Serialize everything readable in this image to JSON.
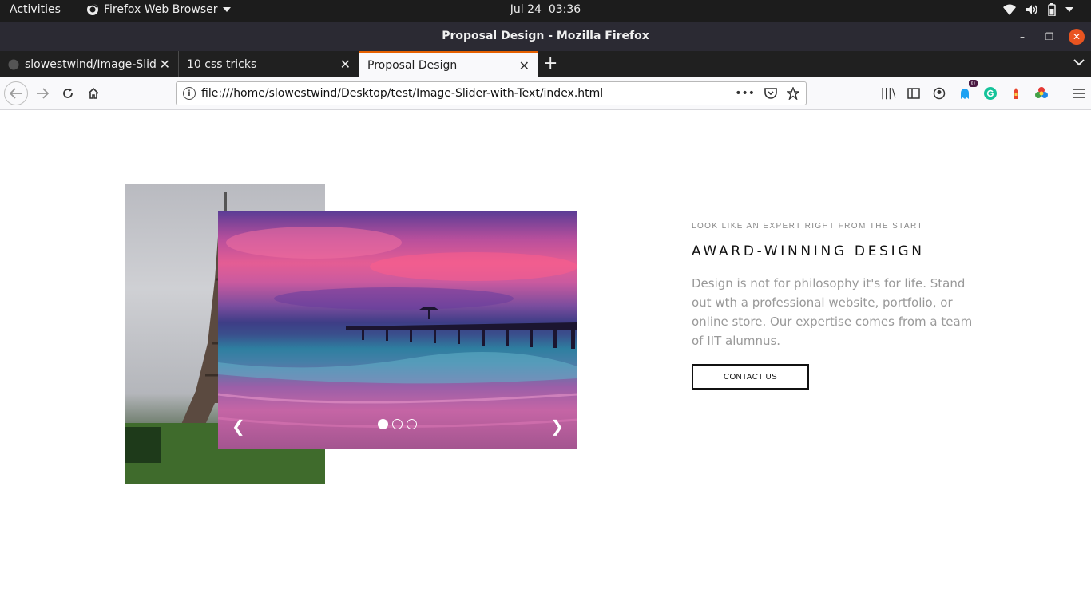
{
  "system_bar": {
    "activities": "Activities",
    "app_name": "Firefox Web Browser",
    "date": "Jul 24",
    "time": "03:36"
  },
  "window": {
    "title": "Proposal Design - Mozilla Firefox"
  },
  "tabs": [
    {
      "label": "slowestwind/Image-Slide",
      "active": false
    },
    {
      "label": "10 css tricks",
      "active": false
    },
    {
      "label": "Proposal Design",
      "active": true
    }
  ],
  "navbar": {
    "url": "file:///home/slowestwind/Desktop/test/Image-Slider-with-Text/index.html",
    "extension_badge": "0"
  },
  "page": {
    "eyebrow": "LOOK LIKE AN EXPERT RIGHT FROM THE START",
    "headline": "AWARD-WINNING DESIGN",
    "body": "Design is not for philosophy it's for life. Stand out wth a professional website, portfolio, or online store. Our expertise comes from a team of IIT alumnus.",
    "cta_label": "CONTACT US",
    "slider": {
      "prev_glyph": "❮",
      "next_glyph": "❯",
      "slide_count": 3,
      "active_slide": 1
    }
  },
  "colors": {
    "accent_close": "#e95420",
    "active_tab_line": "#e66000"
  }
}
